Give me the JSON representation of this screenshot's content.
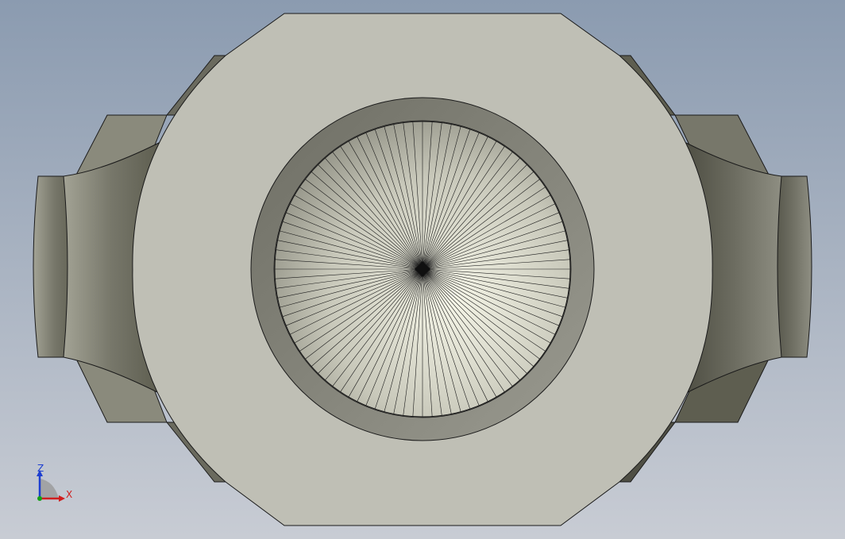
{
  "viewport": {
    "name": "cad-3d-viewport",
    "background_top": "#8b9bb0",
    "background_bottom": "#c8ccd4"
  },
  "model": {
    "name": "valve-body-top-view",
    "face_color": "#bfbfb5",
    "edge_color": "#1a1a1a",
    "side_dark": "#5e5e50",
    "side_mid": "#8a8a7c",
    "bore_ring_color": "#84847a",
    "cone_highlight": "#f6f6e8",
    "cone_shadow": "#8c8c80",
    "radial_lines": 96
  },
  "triad": {
    "z_label": "Z",
    "x_label": "X",
    "z_color": "#1e3fd0",
    "x_color": "#d01e1e",
    "y_color": "#16a016"
  }
}
